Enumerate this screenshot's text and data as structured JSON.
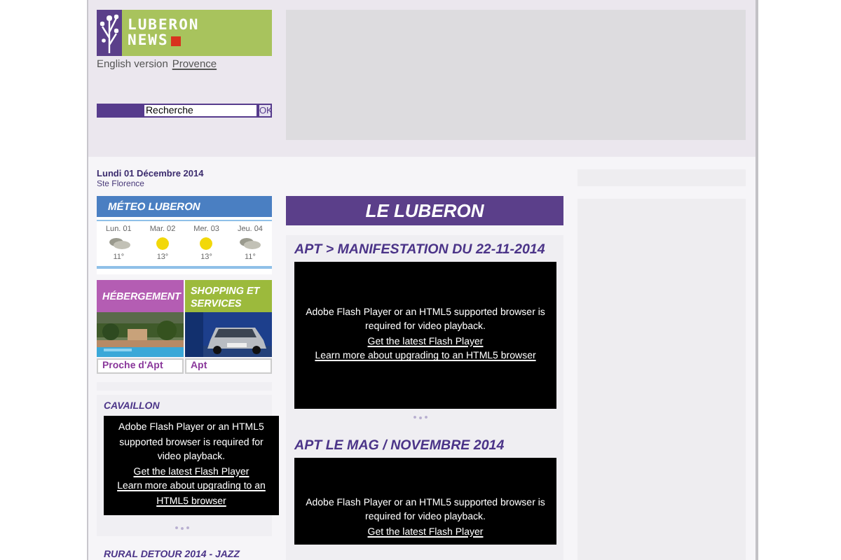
{
  "header": {
    "logo": [
      "LUBERON",
      "NEWS"
    ],
    "language_links": [
      {
        "text": "English version",
        "kind": "text"
      },
      {
        "text": "Provence",
        "kind": "link"
      }
    ],
    "search": {
      "value": "Recherche",
      "button": "OK"
    }
  },
  "date": "Lundi 01 Décembre 2014",
  "saint": "Ste Florence",
  "weather": {
    "title": "MÉTEO LUBERON",
    "days": [
      {
        "day": "Lun. 01",
        "kind": "cloudy",
        "temp": "11°"
      },
      {
        "day": "Mar. 02",
        "kind": "sunny",
        "temp": "13°"
      },
      {
        "day": "Mer. 03",
        "kind": "sunny",
        "temp": "13°"
      },
      {
        "day": "Jeu. 04",
        "kind": "cloudy",
        "temp": "11°"
      }
    ]
  },
  "tiles": [
    {
      "title": "HÉBERGEMENT",
      "caption": "Proche d'Apt",
      "color": "#b45db3",
      "kind": "village"
    },
    {
      "title": "SHOPPING ET SERVICES",
      "caption": "Apt",
      "color": "#9cba3c",
      "kind": "car"
    }
  ],
  "left_videos": [
    {
      "title": "CAVAILLON",
      "message": "Adobe Flash Player or an HTML5 supported browser is required for video playback.",
      "links": [
        "Get the latest Flash Player",
        "Learn more about upgrading to an HTML5 browser"
      ]
    }
  ],
  "left_next_title": "RURAL DETOUR 2014 - JAZZ",
  "main": {
    "heading": "LE LUBERON",
    "videos": [
      {
        "title": "APT > MANIFESTATION DU 22-11-2014",
        "message": "Adobe Flash Player or an HTML5 supported browser is required for video playback.",
        "links": [
          "Get the latest Flash Player",
          "Learn more about upgrading to an HTML5 browser"
        ]
      },
      {
        "title": "APT LE MAG / NOVEMBRE 2014",
        "message": "Adobe Flash Player or an HTML5 supported browser is required for video playback.",
        "links": [
          "Get the latest Flash Player"
        ]
      }
    ]
  }
}
